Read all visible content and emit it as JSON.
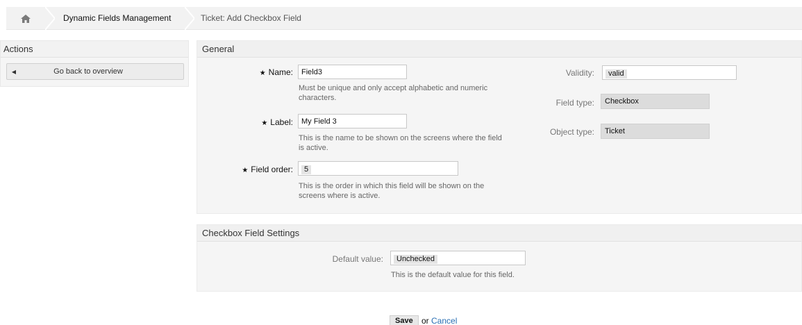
{
  "breadcrumb": {
    "home_icon": "home-icon",
    "items": [
      "Dynamic Fields Management",
      "Ticket: Add Checkbox Field"
    ]
  },
  "sidebar": {
    "title": "Actions",
    "back_label": "Go back to overview"
  },
  "general": {
    "title": "General",
    "name": {
      "label": "Name:",
      "value": "Field3",
      "hint": "Must be unique and only accept alphabetic and numeric characters."
    },
    "label": {
      "label": "Label:",
      "value": "My Field 3",
      "hint": "This is the name to be shown on the screens where the field is active."
    },
    "field_order": {
      "label": "Field order:",
      "value": "5",
      "hint": "This is the order in which this field will be shown on the screens where is active."
    },
    "validity": {
      "label": "Validity:",
      "value": "valid"
    },
    "field_type": {
      "label": "Field type:",
      "value": "Checkbox"
    },
    "object_type": {
      "label": "Object type:",
      "value": "Ticket"
    }
  },
  "settings": {
    "title": "Checkbox Field Settings",
    "default_value": {
      "label": "Default value:",
      "value": "Unchecked",
      "hint": "This is the default value for this field."
    }
  },
  "footer": {
    "save_label": "Save",
    "or_text": "or",
    "cancel_label": "Cancel"
  }
}
